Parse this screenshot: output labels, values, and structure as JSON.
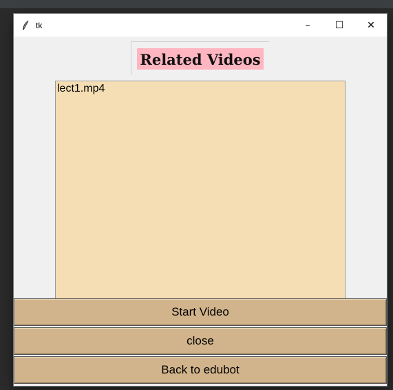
{
  "window": {
    "title": "tk",
    "controls": {
      "minimize": "–",
      "maximize": "☐",
      "close": "✕"
    }
  },
  "heading": "Related Videos",
  "videos": [
    "lect1.mp4"
  ],
  "buttons": {
    "start": "Start Video",
    "close": "close",
    "back": "Back to edubot"
  },
  "colors": {
    "heading_bg": "#ffb6c1",
    "listbox_bg": "#f5deb3",
    "button_bg": "#d2b48c",
    "window_bg": "#f0f0f0"
  }
}
